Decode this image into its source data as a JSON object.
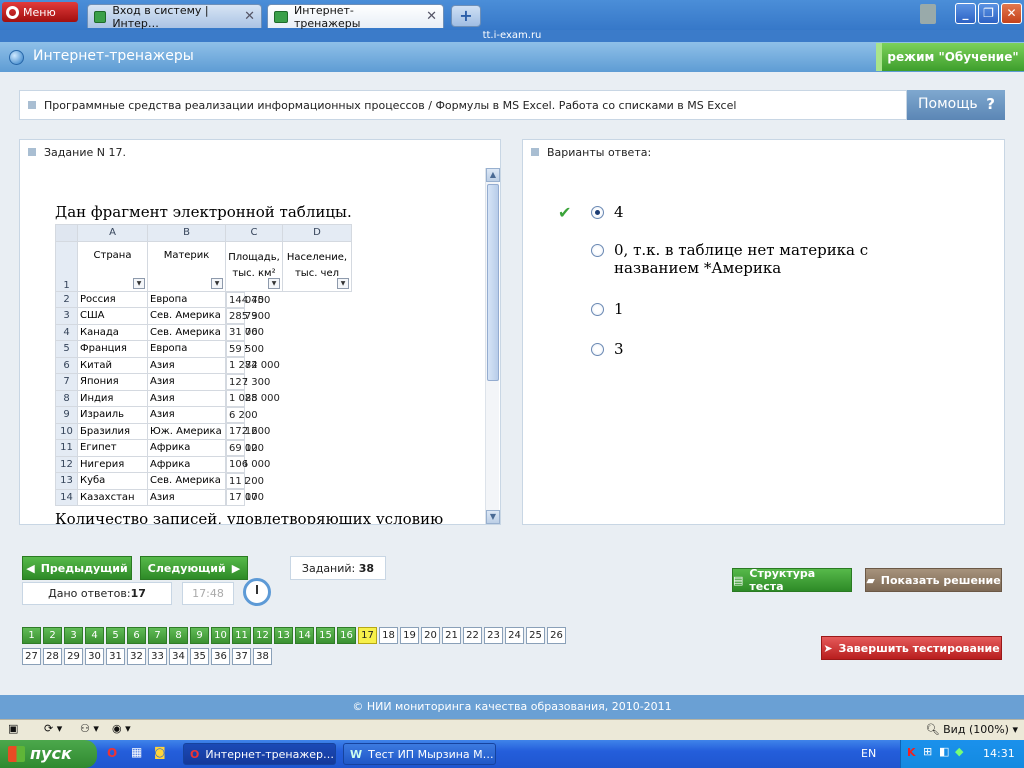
{
  "browser": {
    "menu_label": "Меню",
    "tabs": [
      {
        "label": "Вход в систему | Интер…"
      },
      {
        "label": "Интернет-тренажеры"
      }
    ],
    "url": "tt.i-exam.ru"
  },
  "app": {
    "title": "Интернет-тренажеры",
    "mode": "режим \"Обучение\"",
    "help_label": "Помощь",
    "help_icon": "?",
    "topic": "Программные средства реализации информационных процессов / Формулы в MS Excel. Работа со списками в MS Excel"
  },
  "task": {
    "header": "Задание N 17.",
    "intro": "Дан фрагмент электронной таблицы.",
    "question_cut": "Количество записей, удовлетворяющих условию",
    "sheet": {
      "col_letters": [
        "A",
        "B",
        "C",
        "D"
      ],
      "header_row_num": "1",
      "headers": [
        "Страна",
        "Материк",
        "Площадь, тыс. км²",
        "Население, тыс. чел"
      ],
      "rows": [
        {
          "n": "2",
          "a": "Россия",
          "b": "Европа",
          "c": "17 075",
          "d": "144 400"
        },
        {
          "n": "3",
          "a": "США",
          "b": "Сев. Америка",
          "c": "9 373",
          "d": "285 900"
        },
        {
          "n": "4",
          "a": "Канада",
          "b": "Сев. Америка",
          "c": "9 976",
          "d": "31 000"
        },
        {
          "n": "5",
          "a": "Франция",
          "b": "Европа",
          "c": "552",
          "d": "59 500"
        },
        {
          "n": "6",
          "a": "Китай",
          "b": "Азия",
          "c": "9 572",
          "d": "1 284 000"
        },
        {
          "n": "7",
          "a": "Япония",
          "b": "Азия",
          "c": "372",
          "d": "127 300"
        },
        {
          "n": "8",
          "a": "Индия",
          "b": "Азия",
          "c": "3 288",
          "d": "1 025 000"
        },
        {
          "n": "9",
          "a": "Израиль",
          "b": "Азия",
          "c": "14",
          "d": "6 200"
        },
        {
          "n": "10",
          "a": "Бразилия",
          "b": "Юж. Америка",
          "c": "8 512",
          "d": "172 600"
        },
        {
          "n": "11",
          "a": "Египет",
          "b": "Африка",
          "c": "1 002",
          "d": "69 100"
        },
        {
          "n": "12",
          "a": "Нигерия",
          "b": "Африка",
          "c": "924",
          "d": "106 000"
        },
        {
          "n": "13",
          "a": "Куба",
          "b": "Сев. Америка",
          "c": "111",
          "d": "11 200"
        },
        {
          "n": "14",
          "a": "Казахстан",
          "b": "Азия",
          "c": "2 717",
          "d": "17 000"
        }
      ]
    }
  },
  "answers": {
    "header": "Варианты ответа:",
    "options": [
      {
        "label": "4",
        "selected": true
      },
      {
        "label": "0, т.к. в таблице нет материка с названием *Америка",
        "selected": false
      },
      {
        "label": "1",
        "selected": false
      },
      {
        "label": "3",
        "selected": false
      }
    ]
  },
  "controls": {
    "prev": "Предыдущий",
    "next": "Следующий",
    "tasks_label": "Заданий:",
    "tasks_count": "38",
    "answered_label": "Дано ответов:",
    "answered_count": "17",
    "time": "17:48",
    "structure": "Структура теста",
    "show_solution": "Показать решение",
    "finish": "Завершить тестирование"
  },
  "question_numbers": {
    "row1": [
      "1",
      "2",
      "3",
      "4",
      "5",
      "6",
      "7",
      "8",
      "9",
      "10",
      "11",
      "12",
      "13",
      "14",
      "15",
      "16",
      "17",
      "18",
      "19",
      "20",
      "21",
      "22",
      "23",
      "24",
      "25",
      "26"
    ],
    "row2": [
      "27",
      "28",
      "29",
      "30",
      "31",
      "32",
      "33",
      "34",
      "35",
      "36",
      "37",
      "38"
    ],
    "answered_upto": 16,
    "current": "17"
  },
  "footer": "© НИИ мониторинга качества образования, 2010-2011",
  "statusbar": {
    "zoom": "Вид (100%)"
  },
  "taskbar": {
    "start": "пуск",
    "items": [
      "Интернет-тренажер…",
      "Тест ИП Мырзина М…"
    ],
    "lang": "EN",
    "clock": "14:31"
  }
}
